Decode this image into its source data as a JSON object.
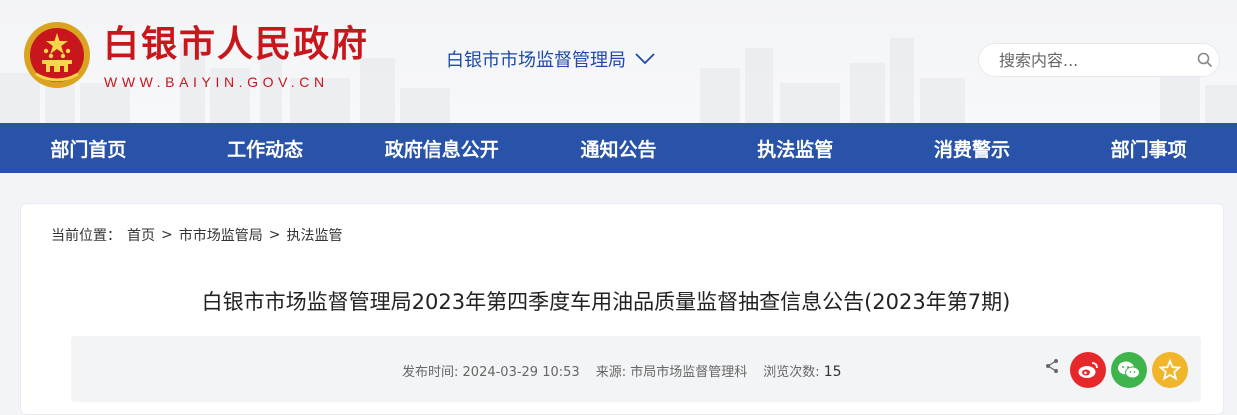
{
  "header": {
    "site_name": "白银市人民政府",
    "site_url": "WWW.BAIYIN.GOV.CN",
    "department": "白银市市场监督管理局",
    "search_placeholder": "搜索内容..."
  },
  "nav": {
    "items": [
      "部门首页",
      "工作动态",
      "政府信息公开",
      "通知公告",
      "执法监管",
      "消费警示",
      "部门事项"
    ]
  },
  "breadcrumb": {
    "prefix": "当前位置：",
    "items": [
      "首页",
      "市市场监管局",
      "执法监管"
    ],
    "separator": ">"
  },
  "article": {
    "title": "白银市市场监督管理局2023年第四季度车用油品质量监督抽查信息公告(2023年第7期)",
    "publish_label": "发布时间:",
    "publish_time": "2024-03-29 10:53",
    "source_label": "来源:",
    "source": "市局市场监督管理科",
    "views_label": "浏览次数:",
    "views": "15"
  },
  "colors": {
    "brand_red": "#c8161d",
    "nav_blue": "#2853a8",
    "weibo": "#e6282a",
    "wechat": "#3fb44a",
    "favorite": "#f0b52b"
  },
  "icons": [
    "national-emblem-icon",
    "chevron-down-icon",
    "search-icon",
    "share-icon",
    "weibo-icon",
    "wechat-icon",
    "favorite-star-icon"
  ]
}
